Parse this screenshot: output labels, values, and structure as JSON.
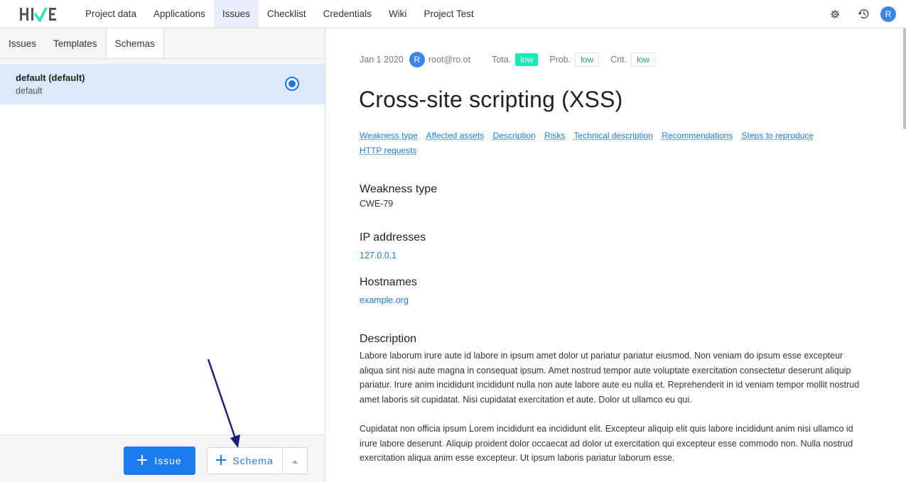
{
  "app": {
    "logo_text": "HIVE"
  },
  "nav": {
    "items": [
      {
        "label": "Project data"
      },
      {
        "label": "Applications"
      },
      {
        "label": "Issues"
      },
      {
        "label": "Checklist"
      },
      {
        "label": "Credentials"
      },
      {
        "label": "Wiki"
      },
      {
        "label": "Project Test"
      }
    ],
    "active": "Issues",
    "avatar_letter": "R"
  },
  "sidebar": {
    "tabs": [
      {
        "label": "Issues"
      },
      {
        "label": "Templates"
      },
      {
        "label": "Schemas"
      }
    ],
    "active_tab": "Schemas",
    "schemas": [
      {
        "title": "default (default)",
        "subtitle": "default",
        "selected": true
      }
    ],
    "buttons": {
      "issue_label": "Issue",
      "schema_label": "Schema"
    }
  },
  "issue": {
    "date": "Jan 1 2020",
    "author_avatar": "R",
    "author": "root@ro.ot",
    "total_label": "Tota.",
    "total_value": "low",
    "prob_label": "Prob.",
    "prob_value": "low",
    "crit_label": "Crit.",
    "crit_value": "low",
    "title": "Cross-site scripting (XSS)",
    "toc": [
      "Weakness type",
      "Affected assets",
      "Description",
      "Risks",
      "Technical description",
      "Recommendations",
      "Steps to reproduce",
      "HTTP requests"
    ],
    "weakness_heading": "Weakness type",
    "weakness_value": "CWE-79",
    "ip_heading": "IP addresses",
    "ip_value": "127.0.0.1",
    "hostnames_heading": "Hostnames",
    "hostname_value": "example.org",
    "description_heading": "Description",
    "description_p1": "Labore laborum irure aute id labore in ipsum amet dolor ut pariatur pariatur eiusmod. Non veniam do ipsum esse excepteur aliqua sint nisi aute magna in consequat ipsum. Amet nostrud tempor aute voluptate exercitation consectetur deserunt aliquip pariatur. Irure anim incididunt incididunt nulla non aute labore aute eu nulla et. Reprehenderit in id veniam tempor mollit nostrud amet laboris sit cupidatat. Nisi cupidatat exercitation et aute. Dolor ut ullamco eu qui.",
    "description_p2": "Cupidatat non officia ipsum Lorem incididunt ea incididunt elit. Excepteur aliquip elit quis labore incididunt anim nisi ullamco id irure labore deserunt. Aliquip proident dolor occaecat ad dolor ut exercitation qui excepteur esse commodo non. Nulla nostrud exercitation aliqua anim esse excepteur. Ut ipsum laboris pariatur laborum esse."
  },
  "colors": {
    "accent": "#1a7cf0",
    "selected_row": "#dce9f9",
    "risk_low": "#1de9b6",
    "arrow": "#1a237e"
  }
}
